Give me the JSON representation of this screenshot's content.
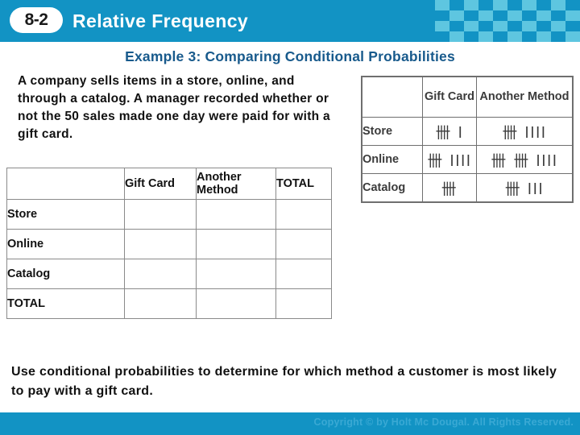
{
  "header": {
    "lesson_number": "8-2",
    "title": "Relative Frequency",
    "bg_color": "#1293c4",
    "check_color": "#5ec6e0"
  },
  "example": {
    "title": "Example 3: Comparing Conditional Probabilities",
    "title_color": "#185a8c"
  },
  "problem": {
    "text": "A company sells items in a store, online, and through a catalog. A manager recorded whether or not the 50 sales made one day were paid for with a gift card."
  },
  "main_table": {
    "corner_label": "",
    "columns": [
      "Gift Card",
      "Another Method",
      "TOTAL"
    ],
    "rows": [
      {
        "label": "Store",
        "cells": [
          "",
          "",
          ""
        ]
      },
      {
        "label": "Online",
        "cells": [
          "",
          "",
          ""
        ]
      },
      {
        "label": "Catalog",
        "cells": [
          "",
          "",
          ""
        ]
      },
      {
        "label": "TOTAL",
        "cells": [
          "",
          "",
          ""
        ]
      }
    ]
  },
  "tally_table": {
    "corner_label": "",
    "columns": [
      "Gift Card",
      "Another Method"
    ],
    "rows": [
      {
        "label": "Store",
        "gift_card": "卌 l",
        "another_method": "卌 llll"
      },
      {
        "label": "Online",
        "gift_card": "卌 llll",
        "another_method": "卌 卌 llll"
      },
      {
        "label": "Catalog",
        "gift_card": "卌",
        "another_method": "卌 lll"
      }
    ]
  },
  "closing": {
    "text": "Use conditional probabilities to determine for which method a customer is most likely to pay with a gift card."
  },
  "footer": {
    "copyright": "Copyright © by Holt Mc Dougal. All Rights Reserved.",
    "bg_color": "#1293c4",
    "text_color": "#3aa9d4"
  }
}
